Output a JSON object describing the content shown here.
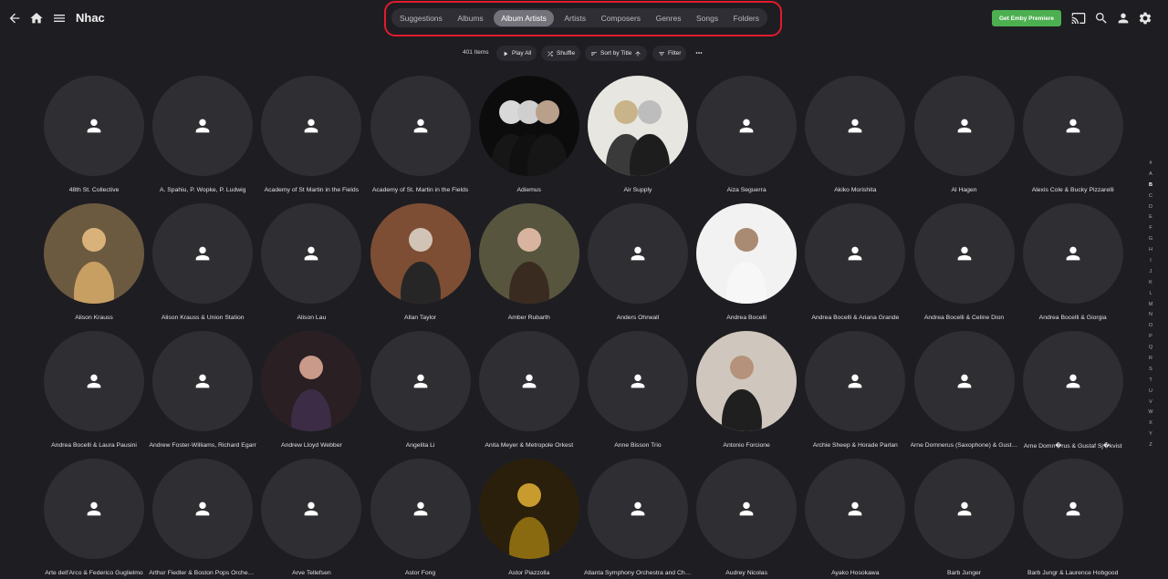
{
  "header": {
    "title": "Nhac",
    "premiere_label": "Get Emby Premiere",
    "tabs": [
      {
        "label": "Suggestions",
        "active": false
      },
      {
        "label": "Albums",
        "active": false
      },
      {
        "label": "Album Artists",
        "active": true
      },
      {
        "label": "Artists",
        "active": false
      },
      {
        "label": "Composers",
        "active": false
      },
      {
        "label": "Genres",
        "active": false
      },
      {
        "label": "Songs",
        "active": false
      },
      {
        "label": "Folders",
        "active": false
      }
    ]
  },
  "toolbar": {
    "count": "401 Items",
    "play_all": "Play All",
    "shuffle": "Shuffle",
    "sort": "Sort by Title",
    "filter": "Filter"
  },
  "artists": [
    {
      "name": "48th St. Collective",
      "image": "placeholder"
    },
    {
      "name": "A. Spahiu, P. Wopke, P. Ludwig",
      "image": "placeholder"
    },
    {
      "name": "Academy of St Martin in the Fields",
      "image": "placeholder"
    },
    {
      "name": "Academy of St. Martin in the Fields",
      "image": "placeholder"
    },
    {
      "name": "Adiemus",
      "image": "photo"
    },
    {
      "name": "Air Supply",
      "image": "photo"
    },
    {
      "name": "Aiza Seguerra",
      "image": "placeholder"
    },
    {
      "name": "Akiko Morishita",
      "image": "placeholder"
    },
    {
      "name": "Al Hagen",
      "image": "placeholder"
    },
    {
      "name": "Alexis Cole & Bucky Pizzarelli",
      "image": "placeholder"
    },
    {
      "name": "Alison Krauss",
      "image": "photo"
    },
    {
      "name": "Alison Krauss & Union Station",
      "image": "placeholder"
    },
    {
      "name": "Alison Lau",
      "image": "placeholder"
    },
    {
      "name": "Allan Taylor",
      "image": "photo"
    },
    {
      "name": "Amber Rubarth",
      "image": "photo"
    },
    {
      "name": "Anders Ohrwall",
      "image": "placeholder"
    },
    {
      "name": "Andrea Bocelli",
      "image": "photo"
    },
    {
      "name": "Andrea Bocelli & Ariana Grande",
      "image": "placeholder"
    },
    {
      "name": "Andrea Bocelli & Celine Dion",
      "image": "placeholder"
    },
    {
      "name": "Andrea Bocelli & Giorgia",
      "image": "placeholder"
    },
    {
      "name": "Andrea Bocelli & Laura Pausini",
      "image": "placeholder"
    },
    {
      "name": "Andrew Foster-Williams, Richard Egarr",
      "image": "placeholder"
    },
    {
      "name": "Andrew Lloyd Webber",
      "image": "photo"
    },
    {
      "name": "Angelita Li",
      "image": "placeholder"
    },
    {
      "name": "Anita Meyer & Metropole Orkest",
      "image": "placeholder"
    },
    {
      "name": "Anne Bisson Trio",
      "image": "placeholder"
    },
    {
      "name": "Antonio Forcione",
      "image": "photo"
    },
    {
      "name": "Archie Sheep & Horade Parlan",
      "image": "placeholder"
    },
    {
      "name": "Arne Domnerus (Saxophone) & Gustaf Sjokvist",
      "image": "placeholder"
    },
    {
      "name": "Arne Domn�rus & Gustaf Sj�kvist",
      "image": "placeholder"
    },
    {
      "name": "Arte dell'Arco & Federico Guglielmo",
      "image": "placeholder"
    },
    {
      "name": "Arthur Fiedler & Boston Pops Orchestra",
      "image": "placeholder"
    },
    {
      "name": "Arve Tellefsen",
      "image": "placeholder"
    },
    {
      "name": "Astor Fong",
      "image": "placeholder"
    },
    {
      "name": "Astor Piazzolla",
      "image": "photo"
    },
    {
      "name": "Atlanta Symphony Orchestra and Chorus",
      "image": "placeholder"
    },
    {
      "name": "Audrey Nicolas",
      "image": "placeholder"
    },
    {
      "name": "Ayako Hosokawa",
      "image": "placeholder"
    },
    {
      "name": "Barb Junger",
      "image": "placeholder"
    },
    {
      "name": "Barb Jungr & Laurence Hobgood",
      "image": "placeholder"
    }
  ],
  "alphabet": [
    "#",
    "A",
    "B",
    "C",
    "D",
    "E",
    "F",
    "G",
    "H",
    "I",
    "J",
    "K",
    "L",
    "M",
    "N",
    "O",
    "P",
    "Q",
    "R",
    "S",
    "T",
    "U",
    "V",
    "W",
    "X",
    "Y",
    "Z"
  ],
  "current_letter": "B",
  "colors": {
    "background": "#1e1d22",
    "accent_green": "#4caf50",
    "highlight_red": "#e21b2d",
    "active_tab": "#74737c"
  }
}
